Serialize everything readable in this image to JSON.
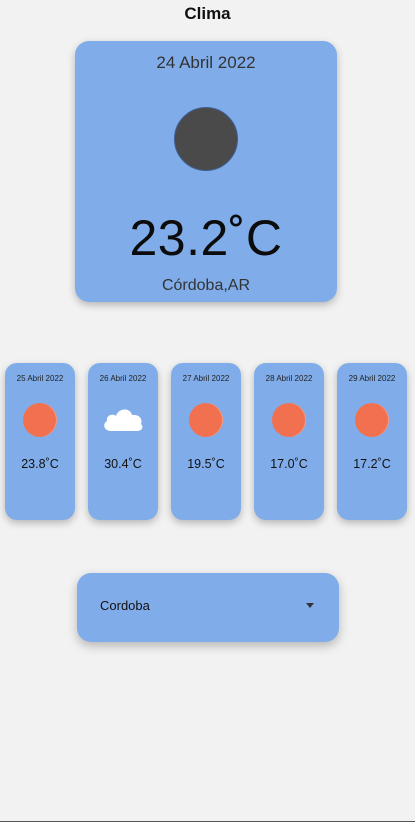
{
  "app": {
    "title": "Clima"
  },
  "current": {
    "date": "24 Abril 2022",
    "icon": "moon-icon",
    "temperature": "23.2˚C",
    "location": "Córdoba,AR"
  },
  "forecast": [
    {
      "date": "25 Abril 2022",
      "icon": "sun-icon",
      "temperature": "23.8˚C"
    },
    {
      "date": "26 Abril 2022",
      "icon": "cloud-icon",
      "temperature": "30.4˚C"
    },
    {
      "date": "27 Abril 2022",
      "icon": "sun-icon",
      "temperature": "19.5˚C"
    },
    {
      "date": "28 Abril 2022",
      "icon": "sun-icon",
      "temperature": "17.0˚C"
    },
    {
      "date": "29 Abril 2022",
      "icon": "sun-icon",
      "temperature": "17.2˚C"
    }
  ],
  "city_select": {
    "selected": "Cordoba"
  },
  "colors": {
    "background": "#f2f2f2",
    "card": "#80adea",
    "sun": "#f07050",
    "moon": "#4a4a4a"
  }
}
